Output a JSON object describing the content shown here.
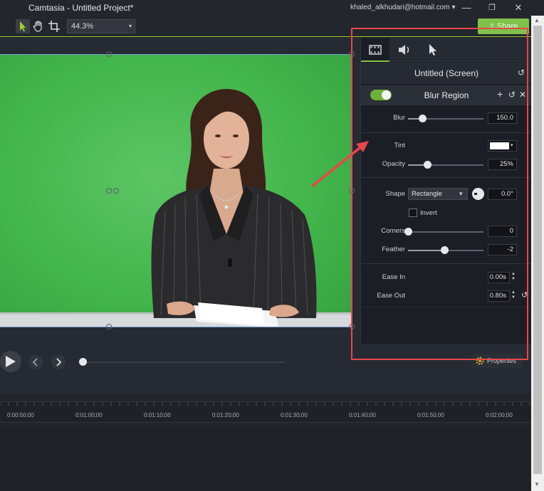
{
  "window": {
    "title": "Camtasia - Untitled Project*",
    "account": "khaled_alkhudari@hotmail.com",
    "account_caret": "▾",
    "minimize": "—",
    "restore": "❐",
    "close": "✕"
  },
  "toolbar": {
    "zoom": "44.3%",
    "zoom_caret": "▾",
    "share_label": "Share"
  },
  "panel": {
    "title": "Untitled (Screen)",
    "effect": {
      "name": "Blur Region",
      "enabled": true,
      "add": "+",
      "reset": "↺",
      "remove": "✕"
    },
    "blur": {
      "label": "Blur",
      "value": "150.0",
      "fraction": 0.19
    },
    "tint": {
      "label": "Tint",
      "color": "#ffffff",
      "caret": "▾"
    },
    "opacity": {
      "label": "Opacity",
      "value": "25%",
      "fraction": 0.25
    },
    "shape": {
      "label": "Shape",
      "selected": "Rectangle",
      "angle": "0.0°",
      "caret": "▾"
    },
    "invert": {
      "label": "Invert",
      "checked": false
    },
    "corners": {
      "label": "Corners",
      "value": "0",
      "fraction": 0.0
    },
    "feather": {
      "label": "Feather",
      "value": "-2",
      "fraction": 0.48
    },
    "ease_in": {
      "label": "Ease In",
      "value": "0.00s"
    },
    "ease_out": {
      "label": "Ease Out",
      "value": "0.80s"
    },
    "spin_up": "▲",
    "spin_down": "▼",
    "reset_glyph": "↺"
  },
  "playback": {
    "properties_label": "Properties"
  },
  "timeline": {
    "ticks": [
      "0:00:50;00",
      "0:01:00;00",
      "0:01:10;00",
      "0:01:20;00",
      "0:01:30;00",
      "0:01:40;00",
      "0:01:50;00",
      "0:02:00;00"
    ]
  },
  "scrollbar": {
    "up": "▲",
    "down": "▼"
  },
  "colors": {
    "accent_green": "#7fc24a",
    "annotation_red": "#e8474b",
    "green_screen": "#43b64c"
  },
  "icons": {
    "select": "select-arrow-icon",
    "pan": "hand-icon",
    "crop": "crop-icon",
    "visual_tab": "film-icon",
    "audio_tab": "speaker-icon",
    "cursor_tab": "cursor-icon",
    "play": "play-icon",
    "prev": "chevron-left-icon",
    "next": "chevron-right-icon",
    "properties": "gear-icon"
  }
}
